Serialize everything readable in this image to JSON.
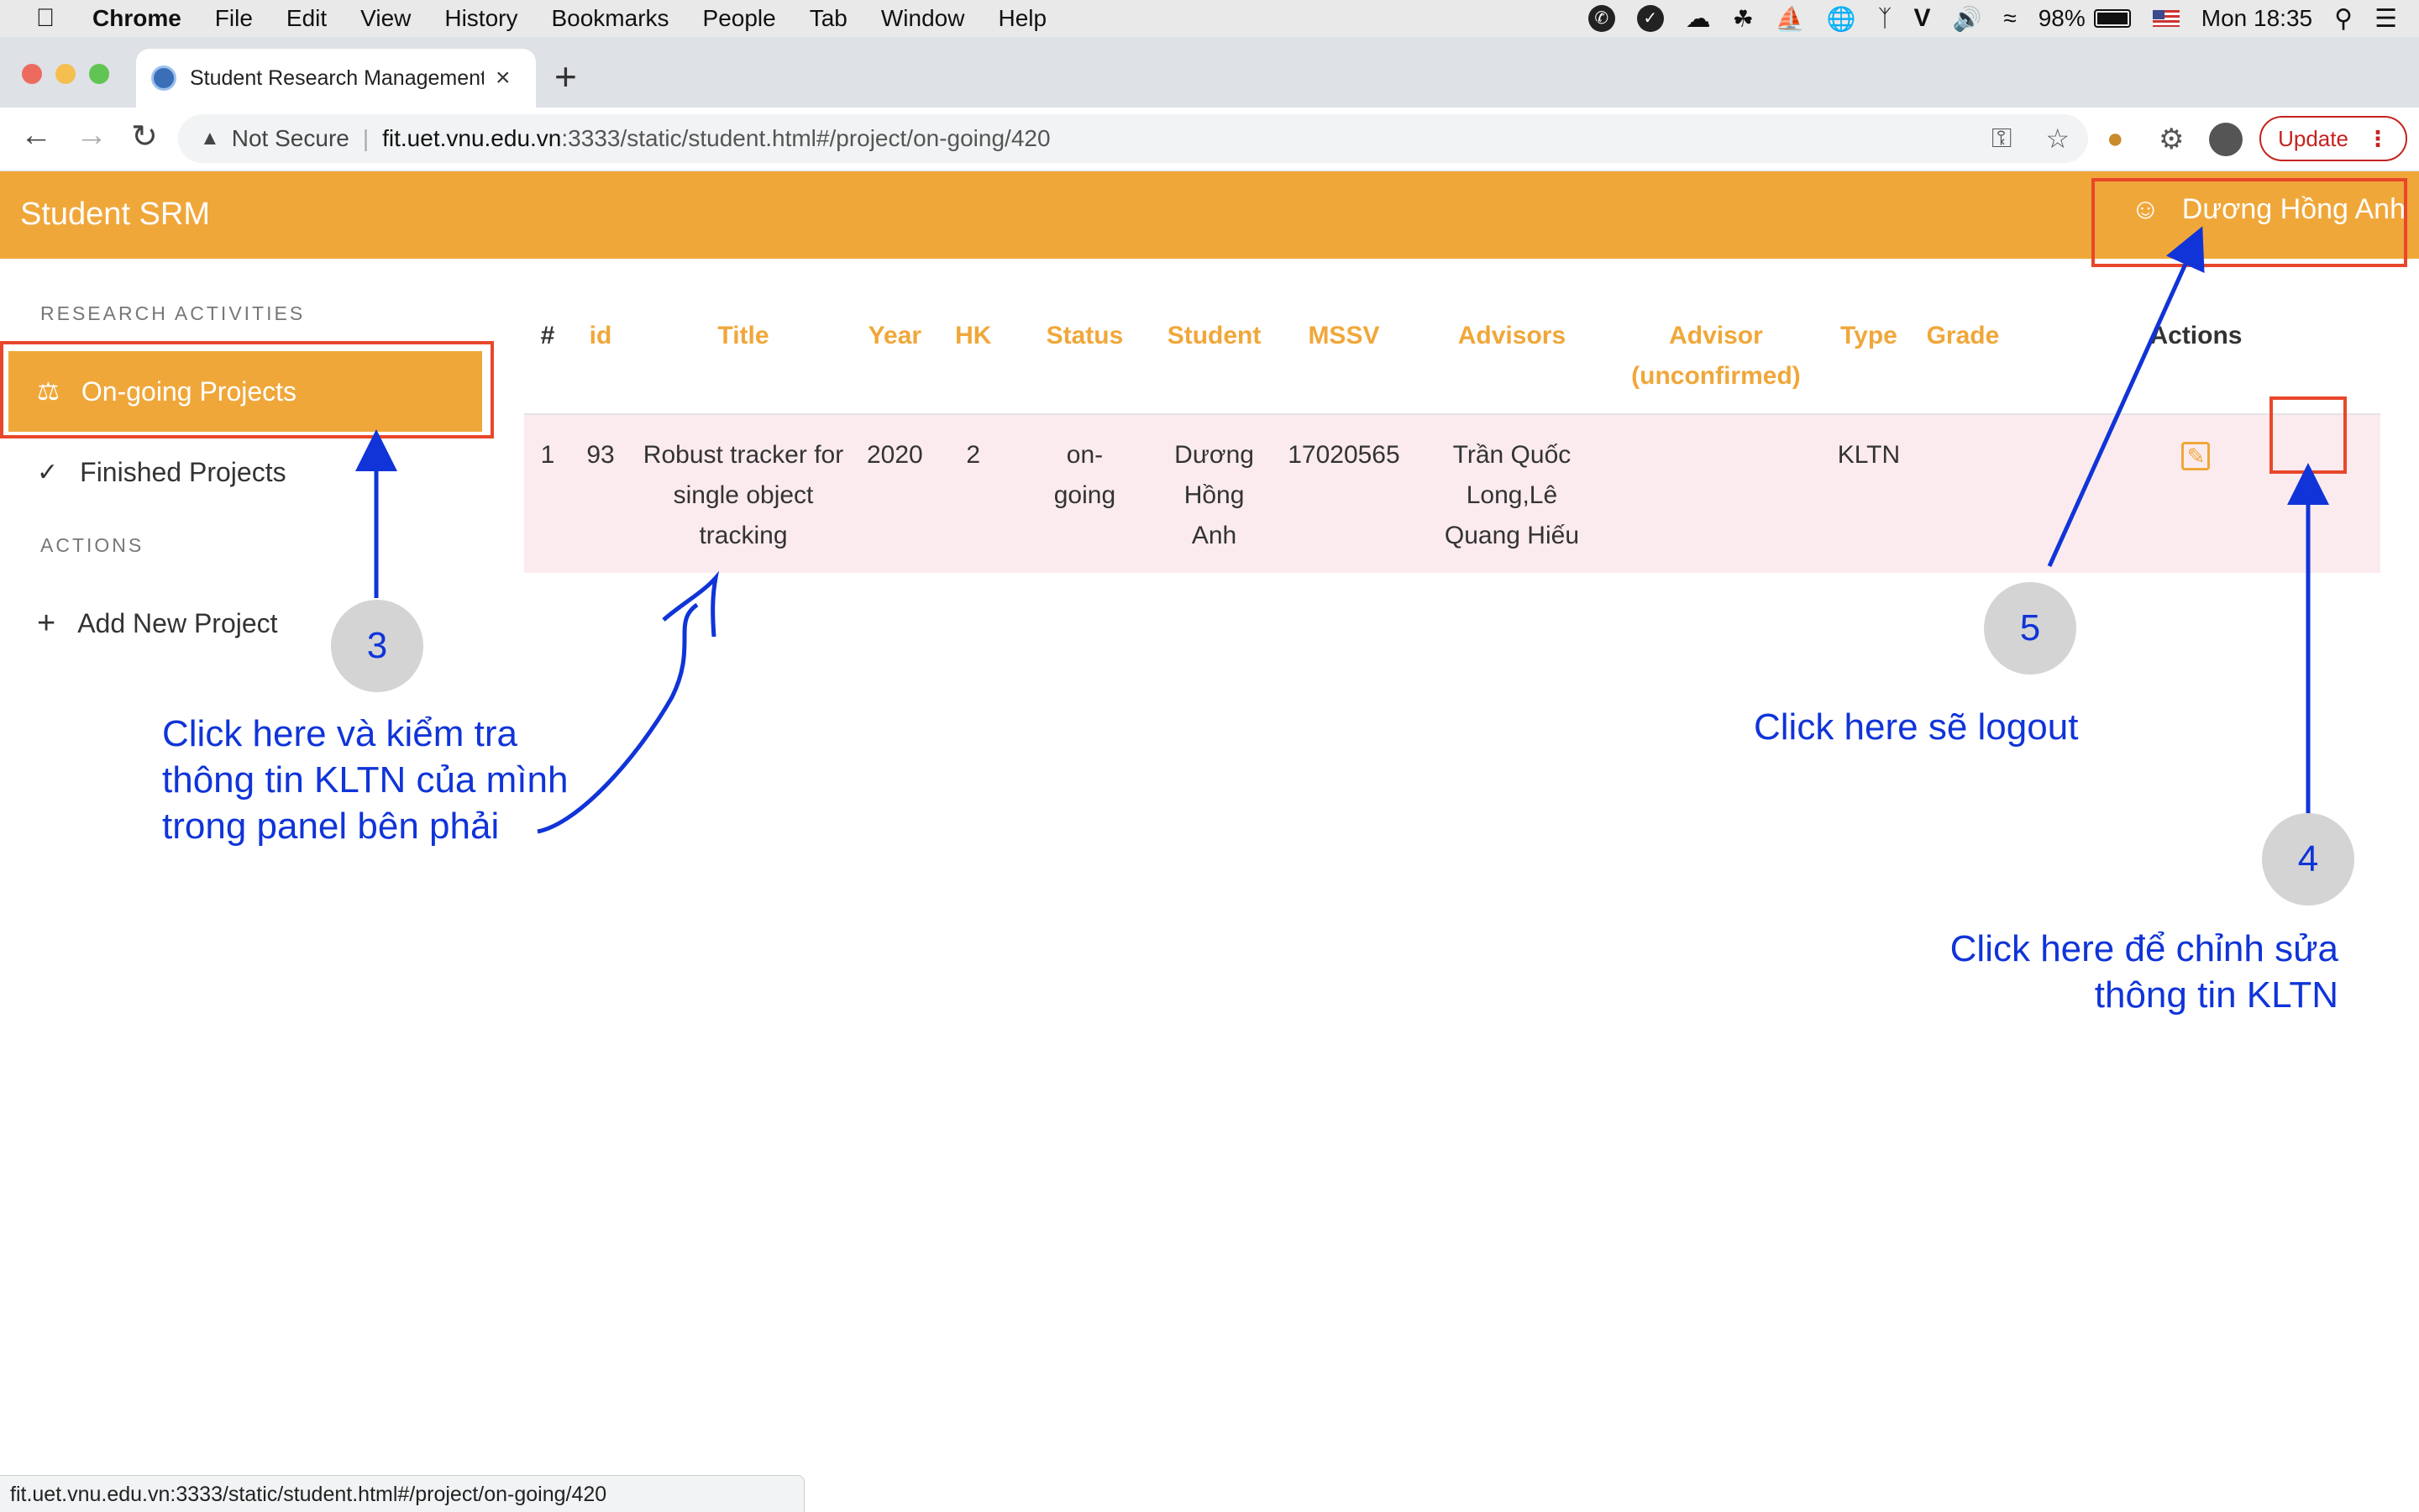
{
  "macos_menubar": {
    "apple_icon": "apple-icon",
    "app_name": "Chrome",
    "items": [
      "File",
      "Edit",
      "View",
      "History",
      "Bookmarks",
      "People",
      "Tab",
      "Window",
      "Help"
    ],
    "battery": "98%",
    "flag_icon": "us-flag-icon",
    "clock": "Mon 18:35"
  },
  "browser": {
    "tab_title": "Student Research Management",
    "tab_close": "×",
    "new_tab": "+",
    "security_label": "Not Secure",
    "url_host": "fit.uet.vnu.edu.vn",
    "url_rest": ":3333/static/student.html#/project/on-going/420",
    "update_label": "Update",
    "status_url": "fit.uet.vnu.edu.vn:3333/static/student.html#/project/on-going/420"
  },
  "header": {
    "brand": "Student SRM",
    "user_name": "Dương Hồng Anh"
  },
  "sidebar": {
    "research_heading": "RESEARCH ACTIVITIES",
    "items": [
      {
        "label": "On-going Projects",
        "icon": "flask-icon",
        "active": true
      },
      {
        "label": "Finished Projects",
        "icon": "check-icon",
        "active": false
      }
    ],
    "actions_heading": "ACTIONS",
    "add_label": "Add New Project"
  },
  "table": {
    "columns": [
      "#",
      "id",
      "Title",
      "Year",
      "HK",
      "Status",
      "Student",
      "MSSV",
      "Advisors",
      "Advisor (unconfirmed)",
      "Type",
      "Grade",
      "Actions"
    ],
    "rows": [
      {
        "index": "1",
        "id": "93",
        "title": "Robust tracker for single object tracking",
        "year": "2020",
        "hk": "2",
        "status": "on-going",
        "student": "Dương Hồng Anh",
        "mssv": "17020565",
        "advisors": "Trần Quốc Long,Lê Quang Hiếu",
        "advisor_unconfirmed": "",
        "type": "KLTN",
        "grade": "",
        "action_icon": "edit-icon"
      }
    ]
  },
  "annotations": {
    "step3": "3",
    "step4": "4",
    "step5": "5",
    "note3_lines": [
      "Click here và kiểm tra",
      "thông tin KLTN của mình",
      "trong panel bên phải"
    ],
    "note4_lines": [
      "Click here để chỉnh sửa",
      "thông tin KLTN"
    ],
    "note5": "Click here sẽ logout",
    "colors": {
      "annotation_blue": "#1034d8",
      "highlight_red": "#e8472b",
      "brand_orange": "#f0a73a"
    }
  }
}
